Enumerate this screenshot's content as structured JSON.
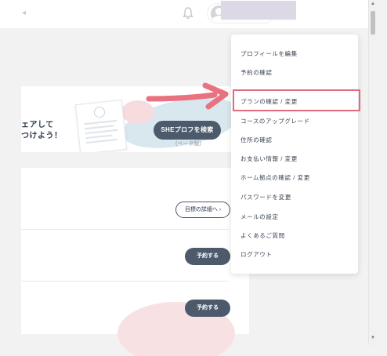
{
  "header": {
    "collapse_glyph": "◂",
    "bell_icon": "bell-icon",
    "avatar_icon": "user-avatar-icon"
  },
  "promo": {
    "text_line1": "ェアして",
    "text_line2": "つけよう！",
    "button_label": "SHEプロフを検索",
    "beta_note": "(ベータ版)"
  },
  "main": {
    "goal_button": "目標の詳細へ ›",
    "reserve_button_1": "予約する",
    "reserve_button_2": "予約する"
  },
  "dropdown": {
    "items": [
      {
        "label": "プロフィールを編集"
      },
      {
        "label": "予約の確認"
      },
      {
        "label": "プランの確認 / 変更"
      },
      {
        "label": "コースのアップグレード"
      },
      {
        "label": "住所の確認"
      },
      {
        "label": "お支払い情報 / 変更"
      },
      {
        "label": "ホーム拠点の確認 / 変更"
      },
      {
        "label": "パスワードを変更"
      },
      {
        "label": "メールの設定"
      },
      {
        "label": "よくあるご質問"
      },
      {
        "label": "ログアウト"
      }
    ],
    "highlighted_index": 2
  },
  "colors": {
    "highlight": "#e06a7e",
    "button_dark": "#4c5a6c",
    "arrow": "#e8727f"
  },
  "scrollbar": {
    "up_glyph": "▲",
    "down_glyph": "▼"
  }
}
